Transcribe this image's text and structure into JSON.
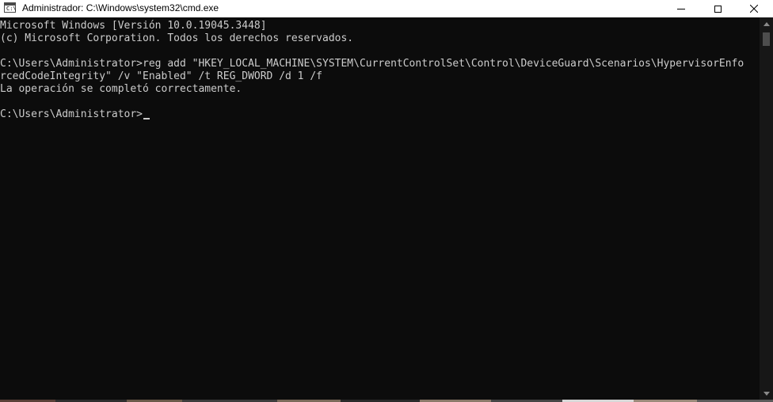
{
  "window": {
    "title": "Administrador: C:\\Windows\\system32\\cmd.exe",
    "icon": "cmd-app-icon",
    "icon_prompt": "C:\\",
    "controls": [
      "minimize-icon",
      "maximize-icon",
      "close-icon"
    ]
  },
  "console": {
    "lines": [
      "Microsoft Windows [Versión 10.0.19045.3448]",
      "(c) Microsoft Corporation. Todos los derechos reservados.",
      "",
      "C:\\Users\\Administrator>reg add \"HKEY_LOCAL_MACHINE\\SYSTEM\\CurrentControlSet\\Control\\DeviceGuard\\Scenarios\\HypervisorEnfo",
      "rcedCodeIntegrity\" /v \"Enabled\" /t REG_DWORD /d 1 /f",
      "La operación se completó correctamente.",
      "",
      "C:\\Users\\Administrator>"
    ]
  },
  "colors": {
    "background": "#0c0c0c",
    "text": "#cccccc",
    "titlebar": "#ffffff"
  }
}
